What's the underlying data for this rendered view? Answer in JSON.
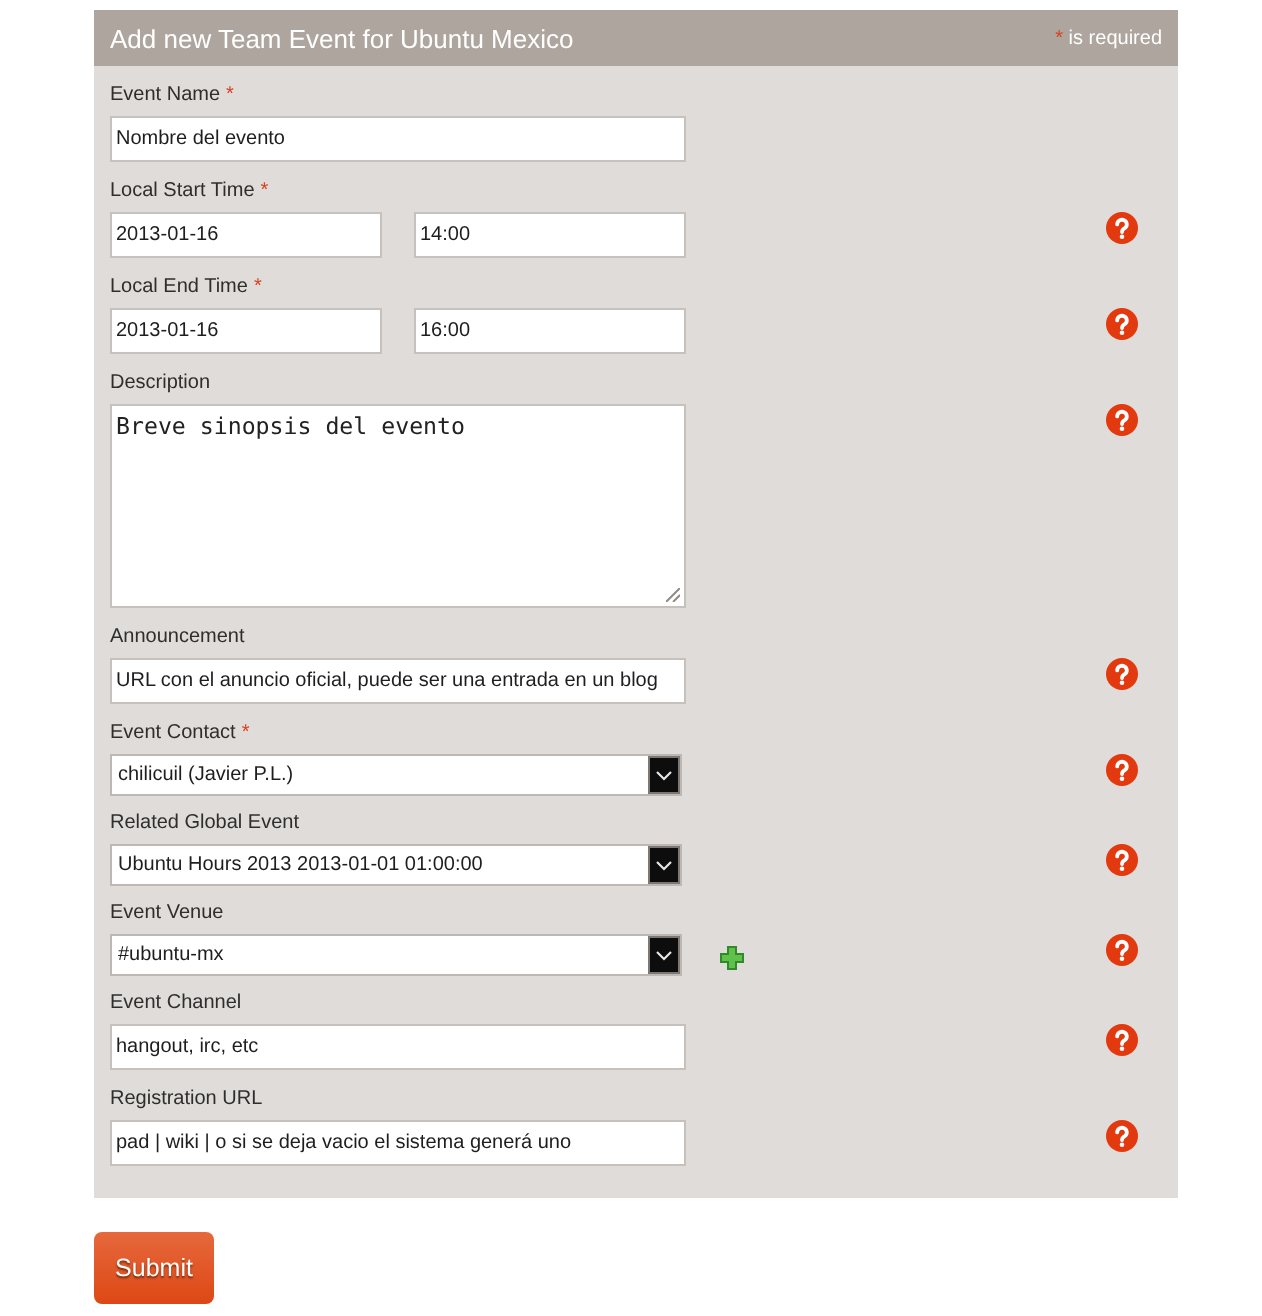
{
  "form": {
    "title": "Add new Team Event for Ubuntu Mexico",
    "required_note": {
      "mark": "*",
      "text": "is required"
    }
  },
  "fields": [
    {
      "kind": "text",
      "label": "Event Name",
      "required_mark": "*",
      "help": false,
      "value": "Nombre del evento"
    },
    {
      "kind": "datetime",
      "label": "Local Start Time",
      "required_mark": "*",
      "help": true,
      "date": "2013-01-16",
      "time": "14:00"
    },
    {
      "kind": "datetime",
      "label": "Local End Time",
      "required_mark": "*",
      "help": true,
      "date": "2013-01-16",
      "time": "16:00"
    },
    {
      "kind": "textarea",
      "label": "Description",
      "help": true,
      "value": "Breve sinopsis del evento"
    },
    {
      "kind": "text",
      "label": "Announcement",
      "help": true,
      "value": "URL con el anuncio oficial, puede ser una entrada en un blog"
    },
    {
      "kind": "select",
      "label": "Event Contact",
      "required_mark": "*",
      "help": true,
      "value": "chilicuil (Javier P.L.)"
    },
    {
      "kind": "select",
      "label": "Related Global Event",
      "help": true,
      "value": "Ubuntu Hours 2013 2013-01-01 01:00:00"
    },
    {
      "kind": "select",
      "label": "Event Venue",
      "help": true,
      "add_button": true,
      "value": "#ubuntu-mx"
    },
    {
      "kind": "text",
      "label": "Event Channel",
      "help": true,
      "value": "hangout, irc, etc"
    },
    {
      "kind": "text",
      "label": "Registration URL",
      "help": true,
      "value": "pad | wiki | o si se deja vacio el sistema generá uno"
    }
  ],
  "submit": {
    "label": "Submit"
  }
}
